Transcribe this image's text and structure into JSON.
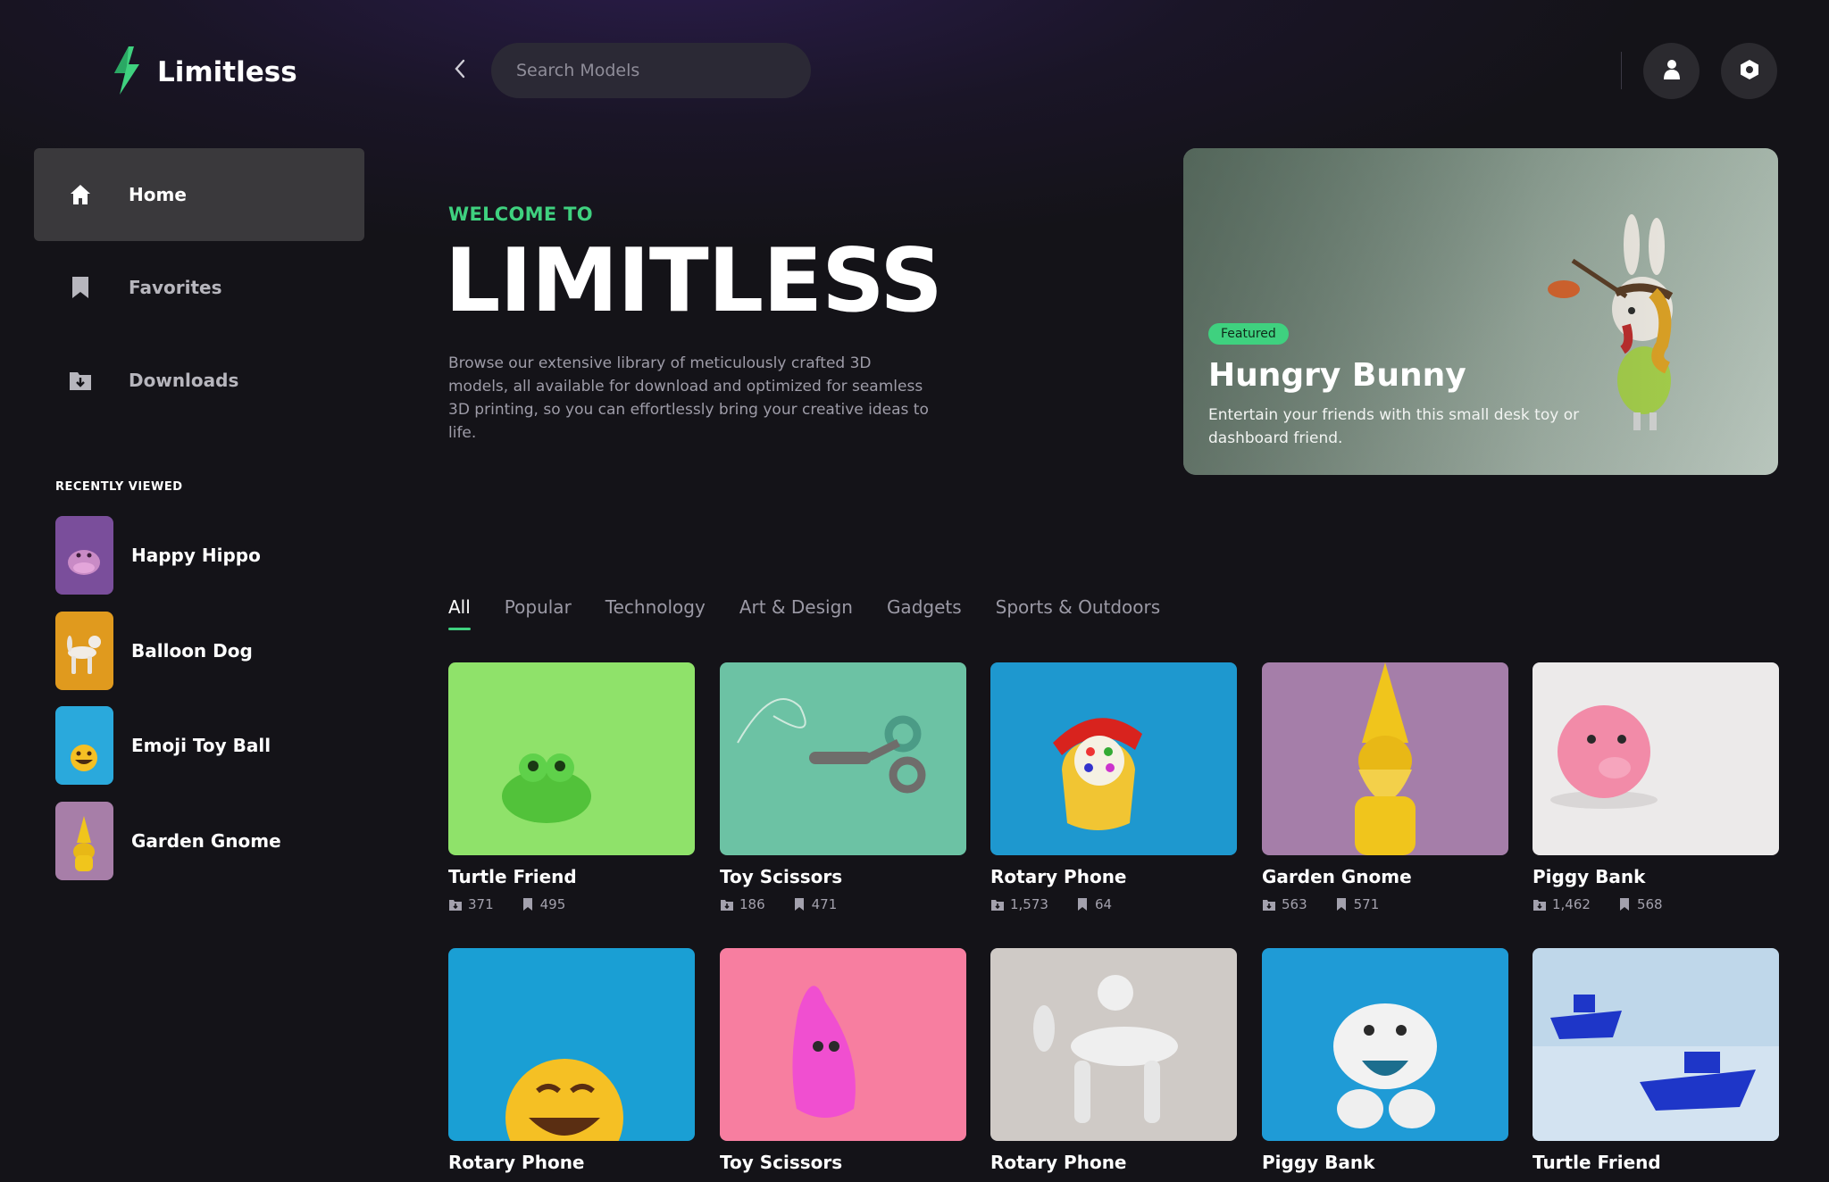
{
  "app": {
    "name": "Limitless"
  },
  "header": {
    "search_placeholder": "Search Models"
  },
  "sidebar": {
    "nav": [
      {
        "label": "Home",
        "icon": "home-icon",
        "active": true
      },
      {
        "label": "Favorites",
        "icon": "bookmark-icon",
        "active": false
      },
      {
        "label": "Downloads",
        "icon": "download-icon",
        "active": false
      }
    ],
    "recent_title": "RECENTLY VIEWED",
    "recent": [
      {
        "label": "Happy Hippo",
        "color": "#7a4e9b"
      },
      {
        "label": "Balloon Dog",
        "color": "#e09a1e"
      },
      {
        "label": "Emoji Toy Ball",
        "color": "#2aa9dc"
      },
      {
        "label": "Garden Gnome",
        "color": "#a77ea8"
      }
    ]
  },
  "hero": {
    "eyebrow": "WELCOME TO",
    "title": "LIMITLESS",
    "description": "Browse our extensive library of meticulously crafted 3D models, all available for download and optimized for seamless 3D printing, so you can effortlessly bring your creative ideas to life."
  },
  "featured": {
    "badge": "Featured",
    "title": "Hungry Bunny",
    "description": "Entertain your friends with this small desk toy or dashboard friend."
  },
  "tabs": [
    "All",
    "Popular",
    "Technology",
    "Art & Design",
    "Gadgets",
    "Sports & Outdoors"
  ],
  "models": [
    {
      "title": "Turtle Friend",
      "downloads": "371",
      "saves": "495",
      "bg": "#8fe26a",
      "accent": "#52c23a"
    },
    {
      "title": "Toy Scissors",
      "downloads": "186",
      "saves": "471",
      "bg": "#6cc2a4",
      "accent": "#6f6d6b"
    },
    {
      "title": "Rotary Phone",
      "downloads": "1,573",
      "saves": "64",
      "bg": "#1e98cf",
      "accent": "#f1c533"
    },
    {
      "title": "Garden Gnome",
      "downloads": "563",
      "saves": "571",
      "bg": "#a57ea9",
      "accent": "#f0c51c"
    },
    {
      "title": "Piggy Bank",
      "downloads": "1,462",
      "saves": "568",
      "bg": "#eceaea",
      "accent": "#f28ba8"
    },
    {
      "title": "Rotary Phone",
      "bg": "#1a9fd4",
      "accent": "#f5c024"
    },
    {
      "title": "Toy Scissors",
      "bg": "#f77ea0",
      "accent": "#f04fd0"
    },
    {
      "title": "Rotary Phone",
      "bg": "#cfcac6",
      "accent": "#efefef"
    },
    {
      "title": "Piggy Bank",
      "bg": "#1f9bd6",
      "accent": "#f2f2f2"
    },
    {
      "title": "Turtle Friend",
      "bg": "#bfd7ea",
      "accent": "#1e36c8"
    }
  ]
}
